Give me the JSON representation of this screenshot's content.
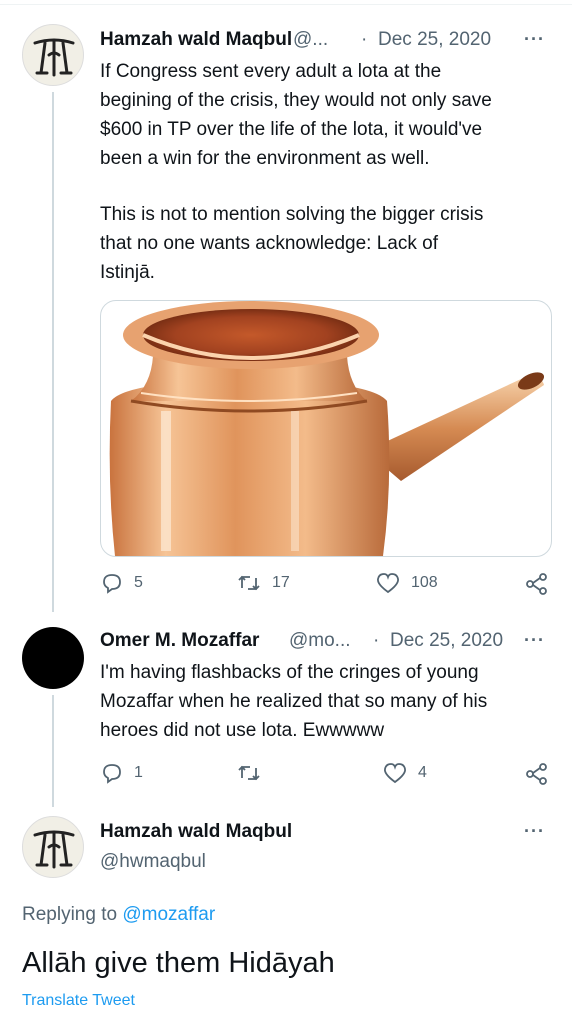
{
  "tweets": [
    {
      "author": "Hamzah wald Maqbul",
      "handle_truncated": "@...",
      "separator": "·",
      "date": "Dec 25, 2020",
      "more": "···",
      "lines": [
        "If Congress sent every adult a lota at the",
        "begining of the crisis, they would not only save",
        "$600 in TP over the life of the lota, it would've",
        "been a win for the environment as well."
      ],
      "lines2": [
        "This is not to mention solving the bigger crisis",
        "that no one wants acknowledge: Lack of",
        "Istinjā."
      ],
      "actions": {
        "replies": "5",
        "retweets": "17",
        "likes": "108"
      },
      "avatar_icon": "calligraphy-logo-icon",
      "media_icon": "copper-lota-image"
    },
    {
      "author": "Omer M. Mozaffar",
      "handle_truncated": "@mo...",
      "separator": "·",
      "date": "Dec 25, 2020",
      "more": "···",
      "lines": [
        "I'm having flashbacks of the cringes of young",
        "Mozaffar when he realized that so many of his",
        "heroes did not use lota. Ewwwww"
      ],
      "actions": {
        "replies": "1",
        "retweets": "",
        "likes": "4"
      }
    }
  ],
  "focused": {
    "author": "Hamzah wald Maqbul",
    "handle": "@hwmaqbul",
    "more": "···",
    "replying_prefix": "Replying to ",
    "replying_handle": "@mozaffar",
    "text": "Allāh give them Hidāyah",
    "translate": "Translate Tweet"
  },
  "colors": {
    "text": "#0f1419",
    "secondary": "#536471",
    "link": "#1d9bf0",
    "thread_line": "#cfd9de"
  }
}
